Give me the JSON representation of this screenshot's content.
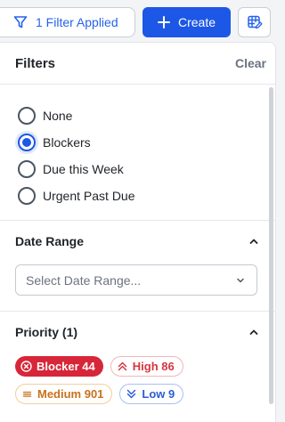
{
  "toolbar": {
    "filter_button_label": "1 Filter Applied",
    "create_button_label": "Create",
    "filter_icon": "funnel-icon",
    "create_icon": "plus-icon",
    "table_icon": "table-edit-icon",
    "accent_color": "#1d57e6"
  },
  "panel": {
    "title": "Filters",
    "clear_label": "Clear",
    "quick_filters": [
      {
        "label": "None",
        "selected": false
      },
      {
        "label": "Blockers",
        "selected": true
      },
      {
        "label": "Due this Week",
        "selected": false
      },
      {
        "label": "Urgent Past Due",
        "selected": false
      }
    ],
    "date_range": {
      "title": "Date Range",
      "placeholder": "Select Date Range..."
    },
    "priority": {
      "title": "Priority (1)",
      "chips": [
        {
          "label": "Blocker 44",
          "icon": "x-circle-icon",
          "selected": true,
          "color": "#d72638"
        },
        {
          "label": "High 86",
          "icon": "double-chevron-up-icon",
          "selected": false,
          "color": "#d6363f"
        },
        {
          "label": "Medium 901",
          "icon": "equals-icon",
          "selected": false,
          "color": "#c9711b"
        },
        {
          "label": "Low 9",
          "icon": "double-chevron-down-icon",
          "selected": false,
          "color": "#2a5fd3"
        }
      ]
    }
  }
}
